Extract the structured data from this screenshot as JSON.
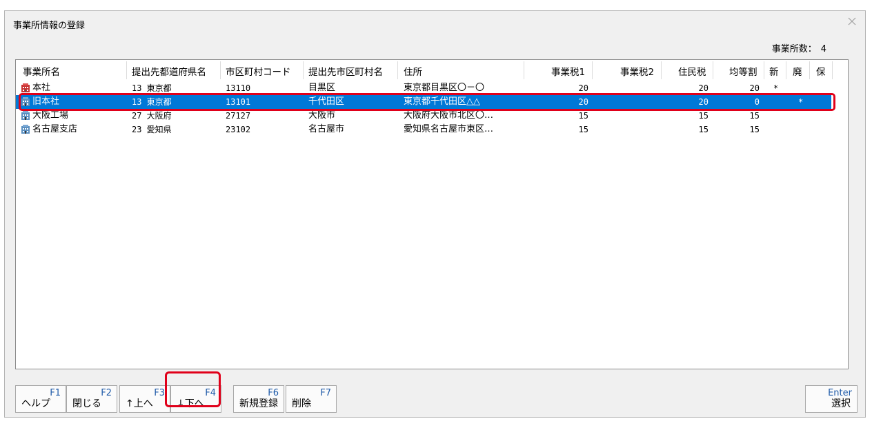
{
  "window": {
    "title": "事業所情報の登録",
    "count_label": "事業所数：",
    "count_value": "4"
  },
  "columns": [
    "事業所名",
    "提出先都道府県名",
    "市区町村コード",
    "提出先市区町村名",
    "住所",
    "事業税1",
    "事業税2",
    "住民税",
    "均等割",
    "新",
    "廃",
    "保"
  ],
  "rows": [
    {
      "name": "本社",
      "pref": "13 東京都",
      "code": "13110",
      "city": "目黒区",
      "address": "東京都目黒区〇－〇",
      "tax1": "20",
      "tax2": "",
      "resident": "20",
      "per_capita": "20",
      "new": "*",
      "closed": "",
      "hold": "",
      "icon": "office-building-red-icon"
    },
    {
      "name": "旧本社",
      "pref": "13 東京都",
      "code": "13101",
      "city": "千代田区",
      "address": "東京都千代田区△△",
      "tax1": "20",
      "tax2": "",
      "resident": "20",
      "per_capita": "0",
      "new": "",
      "closed": "*",
      "hold": "",
      "icon": "office-building-icon",
      "selected": true
    },
    {
      "name": "大阪工場",
      "pref": "27 大阪府",
      "code": "27127",
      "city": "大阪市",
      "address": "大阪府大阪市北区〇…",
      "tax1": "15",
      "tax2": "",
      "resident": "15",
      "per_capita": "15",
      "new": "",
      "closed": "",
      "hold": "",
      "icon": "office-building-icon"
    },
    {
      "name": "名古屋支店",
      "pref": "23 愛知県",
      "code": "23102",
      "city": "名古屋市",
      "address": "愛知県名古屋市東区…",
      "tax1": "15",
      "tax2": "",
      "resident": "15",
      "per_capita": "15",
      "new": "",
      "closed": "",
      "hold": "",
      "icon": "office-building-icon"
    }
  ],
  "function_keys": [
    {
      "key": "F1",
      "label": "ヘルプ"
    },
    {
      "key": "F2",
      "label": "閉じる"
    },
    {
      "key": "F3",
      "label": "↑上へ"
    },
    {
      "key": "F4",
      "label": "↓下へ"
    },
    {
      "key": "F6",
      "label": "新規登録"
    },
    {
      "key": "F7",
      "label": "削除"
    },
    {
      "key": "Enter",
      "label": "選択"
    }
  ],
  "highlight_color": "#e0001a",
  "selection_color": "#0078d7"
}
